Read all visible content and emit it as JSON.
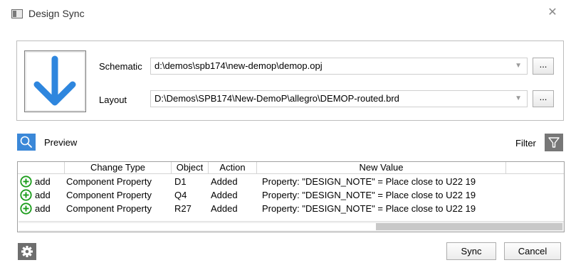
{
  "window": {
    "title": "Design Sync",
    "close_glyph": "✕",
    "icon": "app-window-icon"
  },
  "sync_panel": {
    "sync_icon": "arrow-down-icon",
    "schematic": {
      "label": "Schematic",
      "value": "d:\\demos\\spb174\\new-demop\\demop.opj",
      "browse_label": "..."
    },
    "layout": {
      "label": "Layout",
      "value": "D:\\Demos\\SPB174\\New-DemoP\\allegro\\DEMOP-routed.brd",
      "browse_label": "..."
    }
  },
  "toolbar": {
    "preview_label": "Preview",
    "preview_icon": "search-icon",
    "filter_label": "Filter",
    "filter_icon": "filter-icon"
  },
  "table": {
    "columns": [
      "Change Type",
      "Object",
      "Action",
      "New Value"
    ],
    "rows": [
      {
        "status": "add",
        "change_type": "Component Property",
        "object": "D1",
        "action": "Added",
        "new_value": "Property: \"DESIGN_NOTE\" = Place close to U22 19"
      },
      {
        "status": "add",
        "change_type": "Component Property",
        "object": "Q4",
        "action": "Added",
        "new_value": "Property: \"DESIGN_NOTE\" = Place close to U22 19"
      },
      {
        "status": "add",
        "change_type": "Component Property",
        "object": "R27",
        "action": "Added",
        "new_value": "Property: \"DESIGN_NOTE\" = Place close to U22 19"
      }
    ]
  },
  "footer": {
    "settings_icon": "gear-icon",
    "sync_label": "Sync",
    "cancel_label": "Cancel"
  },
  "colors": {
    "accent_blue": "#3b88d8",
    "add_green": "#1a9c1a",
    "icon_gray": "#6e6e6e"
  }
}
